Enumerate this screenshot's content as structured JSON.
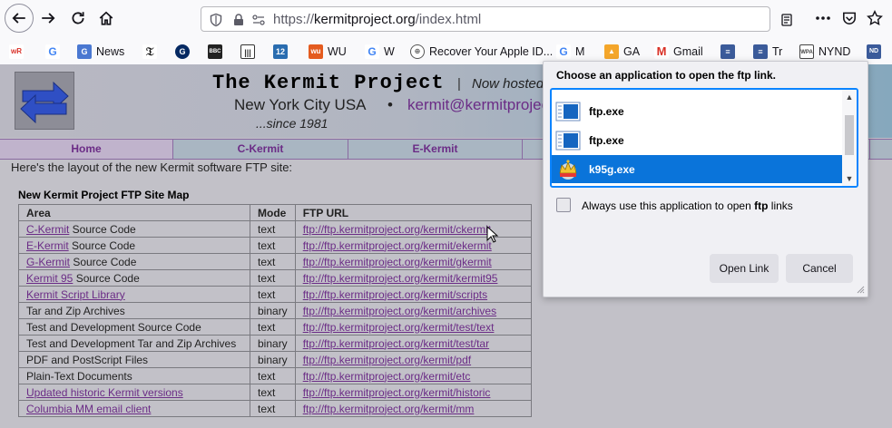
{
  "browser": {
    "url_prefix": "https://",
    "url_host": "kermitproject.org",
    "url_path": "/index.html",
    "icons": {
      "back": "back-arrow-icon",
      "forward": "forward-arrow-icon",
      "reload": "reload-icon",
      "home": "home-icon",
      "shield": "shield-icon",
      "lock": "lock-icon",
      "permissions": "permissions-icon",
      "reader": "reader-view-icon",
      "more": "more-menu-icon",
      "pocket": "pocket-icon",
      "star": "bookmark-star-icon"
    }
  },
  "bookmarks": [
    {
      "label": "",
      "icon": "wr-favicon",
      "color": "#d9322a"
    },
    {
      "label": "",
      "icon": "google-favicon",
      "color": "#4285f4"
    },
    {
      "label": "News",
      "icon": "google-news-favicon",
      "color": "#4a78d1"
    },
    {
      "label": "",
      "icon": "nytimes-favicon",
      "color": "#111111"
    },
    {
      "label": "",
      "icon": "guardian-favicon",
      "color": "#052962"
    },
    {
      "label": "",
      "icon": "bbc-favicon",
      "color": "#222222"
    },
    {
      "label": "",
      "icon": "bars-favicon",
      "color": "#333333"
    },
    {
      "label": "",
      "icon": "channel-12-favicon",
      "color": "#2a6db0"
    },
    {
      "label": "WU",
      "icon": "wu-favicon",
      "color": "#e45b1f"
    },
    {
      "label": "W",
      "icon": "google-favicon",
      "color": "#4285f4"
    },
    {
      "label": "Recover Your Apple ID...",
      "icon": "globe-favicon",
      "color": "#555555"
    },
    {
      "label": "M",
      "icon": "google-favicon",
      "color": "#4285f4"
    },
    {
      "label": "GA",
      "icon": "ga-favicon",
      "color": "#f4a62a"
    },
    {
      "label": "Gmail",
      "icon": "gmail-favicon",
      "color": "#d93025"
    },
    {
      "label": "",
      "icon": "bars-favicon",
      "color": "#3b5b9a"
    },
    {
      "label": "Tr",
      "icon": "tr-favicon",
      "color": "#3b5b9a"
    },
    {
      "label": "NYND",
      "icon": "wpa-favicon",
      "color": "#444444"
    },
    {
      "label": "",
      "icon": "nd-favicon",
      "color": "#3b5b9a"
    }
  ],
  "site": {
    "title": "The Kermit Project",
    "title_sep": "|",
    "tagline": "Now hosted",
    "location": "New York City USA",
    "bullet": "•",
    "email": "kermit@kermitprojec",
    "since": "...since 1981",
    "logo_icon": "kermit-arrows-logo-icon",
    "menu": [
      "Home",
      "C-Kermit",
      "E-Kermit"
    ]
  },
  "content": {
    "intro": "Here's the layout of the new Kermit software FTP site:",
    "map_title": "New Kermit Project FTP Site Map",
    "headers": [
      "Area",
      "Mode",
      "FTP URL"
    ],
    "rows": [
      {
        "link": "C-Kermit",
        "rest": " Source Code",
        "mode": "text",
        "url": "ftp://ftp.kermitproject.org/kermit/ckermit"
      },
      {
        "link": "E-Kermit",
        "rest": " Source Code",
        "mode": "text",
        "url": "ftp://ftp.kermitproject.org/kermit/ekermit"
      },
      {
        "link": "G-Kermit",
        "rest": " Source Code",
        "mode": "text",
        "url": "ftp://ftp.kermitproject.org/kermit/gkermit"
      },
      {
        "link": "Kermit 95",
        "rest": " Source Code",
        "mode": "text",
        "url": "ftp://ftp.kermitproject.org/kermit/kermit95"
      },
      {
        "link": "Kermit Script Library",
        "rest": "",
        "mode": "text",
        "url": "ftp://ftp.kermitproject.org/kermit/scripts"
      },
      {
        "link": "",
        "rest": "Tar and Zip Archives",
        "mode": "binary",
        "url": "ftp://ftp.kermitproject.org/kermit/archives"
      },
      {
        "link": "",
        "rest": "Test and Development Source Code",
        "mode": "text",
        "url": "ftp://ftp.kermitproject.org/kermit/test/text"
      },
      {
        "link": "",
        "rest": "Test and Development Tar and Zip Archives",
        "mode": "binary",
        "url": "ftp://ftp.kermitproject.org/kermit/test/tar"
      },
      {
        "link": "",
        "rest": "PDF and PostScript Files",
        "mode": "binary",
        "url": "ftp://ftp.kermitproject.org/kermit/pdf"
      },
      {
        "link": "",
        "rest": "Plain-Text Documents",
        "mode": "text",
        "url": "ftp://ftp.kermitproject.org/kermit/etc"
      },
      {
        "link": "Updated historic Kermit versions",
        "rest": "",
        "mode": "text",
        "url": "ftp://ftp.kermitproject.org/kermit/historic"
      },
      {
        "link": "Columbia MM email client",
        "rest": "",
        "mode": "text",
        "url": "ftp://ftp.kermitproject.org/kermit/mm"
      }
    ]
  },
  "dialog": {
    "title": "Choose an application to open the ftp link.",
    "apps": [
      {
        "name": "ftp.exe",
        "icon": "ftp-app-icon",
        "selected": false
      },
      {
        "name": "ftp.exe",
        "icon": "ftp-app-icon",
        "selected": false
      },
      {
        "name": "k95g.exe",
        "icon": "kermit-crown-icon",
        "selected": true
      }
    ],
    "always_prefix": "Always use this application to open ",
    "always_bold": "ftp",
    "always_suffix": " links",
    "always_checked": false,
    "open_label": "Open Link",
    "cancel_label": "Cancel"
  }
}
